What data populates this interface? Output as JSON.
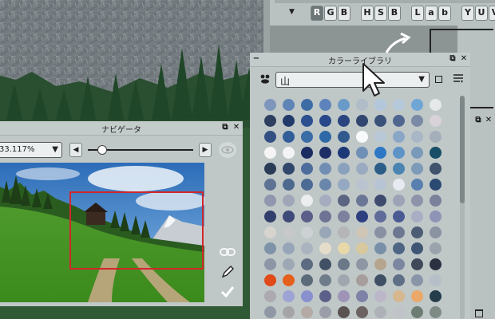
{
  "colors": {
    "panel": "#bfc7c7",
    "accent": "#d2262a"
  },
  "top_strip": {
    "arrow": "▼",
    "mode_groups": [
      [
        "R",
        "G",
        "B"
      ],
      [
        "H",
        "S",
        "B"
      ],
      [
        "L",
        "a",
        "b"
      ],
      [
        "Y",
        "U",
        "V"
      ]
    ],
    "active_letter": "R"
  },
  "color_library": {
    "title": "カラーライブラリ",
    "minimize": "−",
    "float": "⧉",
    "close": "✕",
    "set_value": "山",
    "set_arrow": "▼",
    "palette_icon": "palette-icon",
    "swatches": [
      [
        "#7e96bc",
        "#5f84b6",
        "#3d6ba4",
        "#5d82bc",
        "#6a9ac8",
        "#b0bcc8",
        "#b3c7dc",
        "#b5c9da",
        "#6fa6d6",
        "#e5e9ea"
      ],
      [
        "#2d3e5f",
        "#223a6a",
        "#2b4f8f",
        "#284789",
        "#2a4480",
        "#32466f",
        "#3a527a",
        "#506691",
        "#7a8aa6",
        "#d9d2d9"
      ],
      [
        "#314f82",
        "#315e98",
        "#3a6ca5",
        "#2f68a6",
        "#305a8e",
        "#f7f9fa",
        "#b9c8d6",
        "#8aa6c7",
        "#a9b6c6",
        "#a4afba"
      ],
      [
        "#f4f5f4",
        "#f4f4f6",
        "#1b2c63",
        "#1c2e64",
        "#1d3876",
        "#6f8fb6",
        "#2d77c5",
        "#5e93c6",
        "#7a9aba",
        "#184d67"
      ],
      [
        "#2a3b56",
        "#30466a",
        "#4c6d9c",
        "#718db4",
        "#8aa1bd",
        "#9aabbf",
        "#2c5d86",
        "#4a84b0",
        "#7d9bb8",
        "#40536c"
      ],
      [
        "#5e7293",
        "#4d6a8e",
        "#4b6b95",
        "#6a86ab",
        "#94a8c1",
        "#b9c4d0",
        "#b7c4d4",
        "#e7eaf0",
        "#5880b0",
        "#2b4a72"
      ],
      [
        "#8f96ad",
        "#9fa6b8",
        "#ecedef",
        "#a5acc0",
        "#5b6582",
        "#6b7596",
        "#3f4b6e",
        "#9da3b7",
        "#8d93a9",
        "#7a819b"
      ],
      [
        "#323e6b",
        "#3e4a77",
        "#5a5e88",
        "#6e7396",
        "#7c819d",
        "#2d3f7f",
        "#5f6b98",
        "#4a5a93",
        "#a9aec4",
        "#8d94b5"
      ],
      [
        "#d7d4cf",
        "#c6c8c9",
        "#cdd1d4",
        "#98a6b8",
        "#b4b5b4",
        "#cfc6b6",
        "#8891a4",
        "#6d7792",
        "#4c5c75",
        "#8a93a2"
      ],
      [
        "#7e93a8",
        "#96a6b8",
        "#aab4c0",
        "#e6dcca",
        "#e8d8a8",
        "#d8c89e",
        "#7790a8",
        "#4e6684",
        "#3f5574",
        "#9aa2ac"
      ],
      [
        "#8c96a6",
        "#9ea8b4",
        "#5d6b80",
        "#415064",
        "#6b7888",
        "#8d96a2",
        "#b6a58e",
        "#7d86a0",
        "#40495a",
        "#2c3142"
      ],
      [
        "#e04a18",
        "#e5601c",
        "#5c6b7a",
        "#6f7c8a",
        "#a0a7b0",
        "#a79d9d",
        "#3f5064",
        "#5e6f86",
        "#8a94a8",
        "#b6bec8"
      ],
      [
        "#ada9b0",
        "#9da4d3",
        "#8a8fce",
        "#5b6088",
        "#9e94b8",
        "#7d82a6",
        "#bcb7c8",
        "#d6b78e",
        "#eba868",
        "#253c4b"
      ],
      [
        "#8f98a4",
        "#a5a5a8",
        "#b4aaa6",
        "#9b9ea6",
        "#5b5252",
        "#6d6262",
        "#aeb2b8",
        "#c0c4c8",
        "#6e7d74",
        "#7e8a84"
      ],
      [
        "#b6b0a6",
        "#a6a09a",
        "#8d8a86",
        "#b3b8bc",
        "#c2c6ca",
        "#7e8288",
        "#9c989c",
        "#c0b6ae",
        "#d4d4d2",
        "#9ca0a4"
      ]
    ]
  },
  "navigator": {
    "title": "ナビゲータ",
    "float": "⧉",
    "close": "✕",
    "zoom_value": "33.117%",
    "zoom_arrow": "▼",
    "rotate_left": "◀",
    "rotate_right": "▶",
    "slider_fraction": 0.14
  },
  "side_panel": {
    "float": "⧉",
    "close": "✕"
  }
}
